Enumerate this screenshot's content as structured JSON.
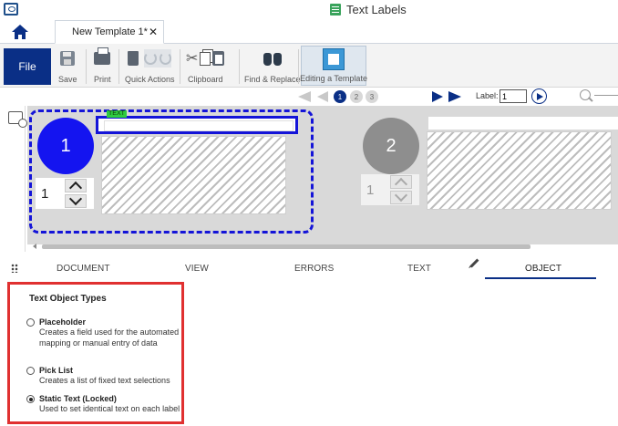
{
  "window": {
    "title": "Text Labels"
  },
  "tabs": {
    "document_tab": "New Template 1*",
    "close_glyph": "✕"
  },
  "ribbon": {
    "file": "File",
    "save": "Save",
    "print": "Print",
    "quick_actions": "Quick Actions",
    "clipboard": "Clipboard",
    "find_replace": "Find & Replace",
    "editing_template": "Editing a Template"
  },
  "nav": {
    "pages": [
      "1",
      "2",
      "3"
    ],
    "label_caption": "Label:",
    "label_value": "1"
  },
  "canvas": {
    "card1": {
      "number": "1",
      "quantity": "1",
      "text_tag": "TEXT"
    },
    "card2": {
      "number": "2",
      "quantity": "1"
    }
  },
  "property_tabs": {
    "document": "DOCUMENT",
    "view": "VIEW",
    "errors": "ERRORS",
    "text": "TEXT",
    "object": "OBJECT"
  },
  "text_object_types": {
    "title": "Text Object Types",
    "options": [
      {
        "name": "Placeholder",
        "description": "Creates a field used for the automated mapping or manual entry of data",
        "selected": false
      },
      {
        "name": "Pick List",
        "description": "Creates a list of fixed text selections",
        "selected": false
      },
      {
        "name": "Static Text (Locked)",
        "description": "Used to set identical text on each label",
        "selected": true
      }
    ]
  },
  "colors": {
    "accent": "#0a2f86",
    "selection": "#1414d8",
    "highlight_border": "#e03030",
    "text_tag": "#2ecc40"
  }
}
